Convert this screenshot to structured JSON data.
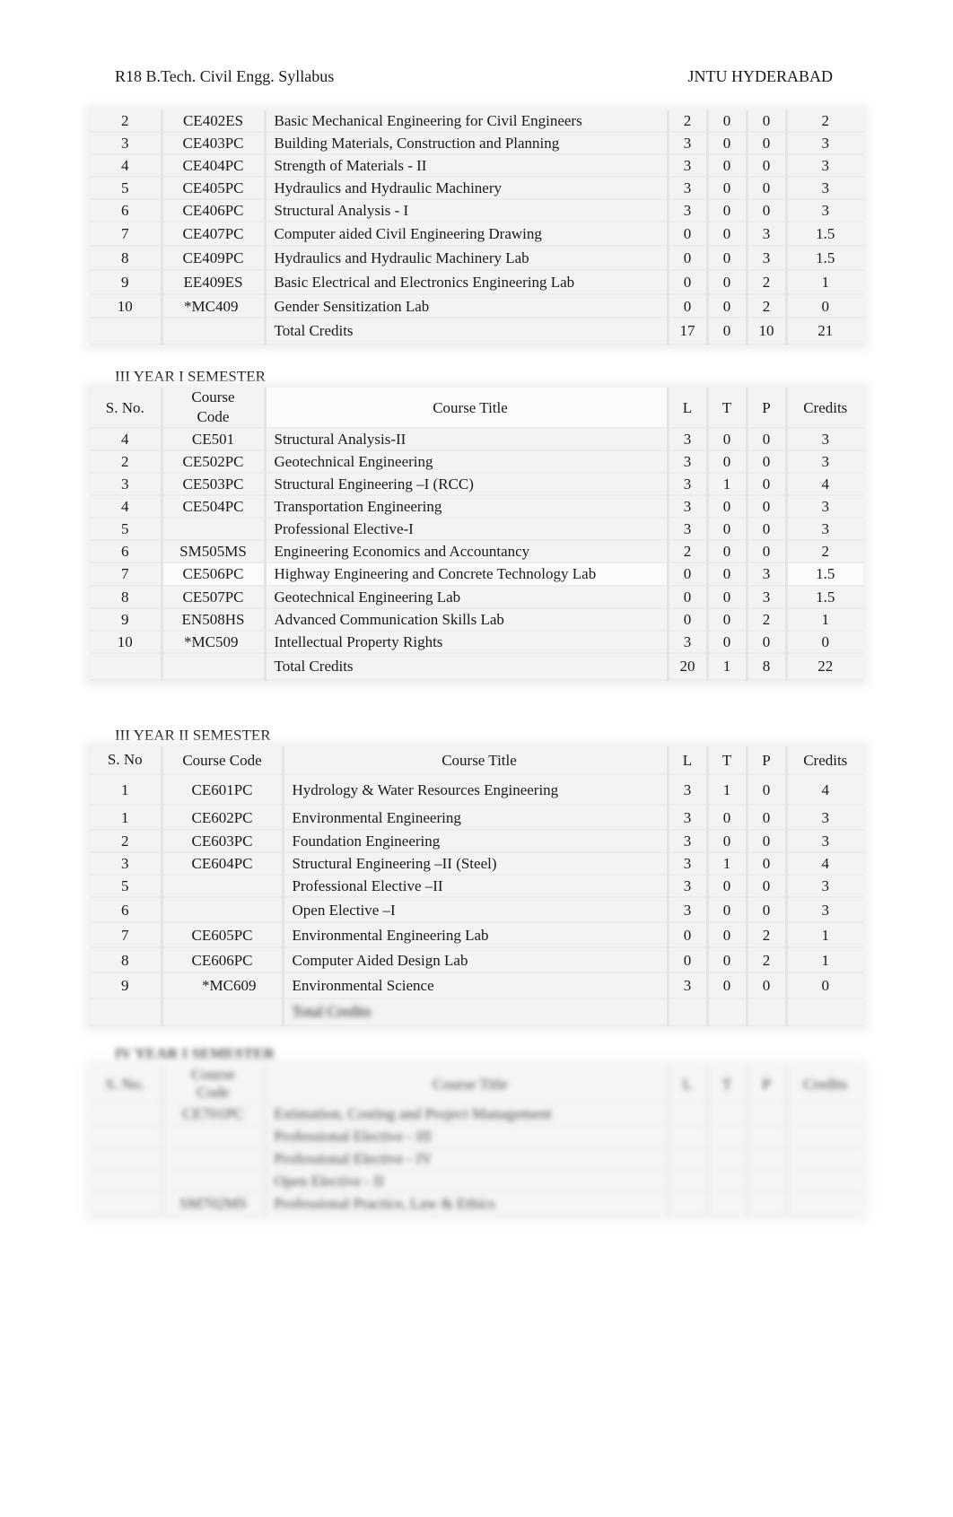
{
  "header": {
    "left": "R18 B.Tech. Civil Engg. Syllabus",
    "right": "JNTU HYDERABAD"
  },
  "table_ii_2": {
    "rows": [
      {
        "sno": "2",
        "code": "CE402ES",
        "title": "Basic Mechanical Engineering for Civil Engineers",
        "l": "2",
        "t": "0",
        "p": "0",
        "credits": "2"
      },
      {
        "sno": "3",
        "code": "CE403PC",
        "title": "Building Materials, Construction and Planning",
        "l": "3",
        "t": "0",
        "p": "0",
        "credits": "3"
      },
      {
        "sno": "4",
        "code": "CE404PC",
        "title": "Strength of Materials - II",
        "l": "3",
        "t": "0",
        "p": "0",
        "credits": "3"
      },
      {
        "sno": "5",
        "code": "CE405PC",
        "title": "Hydraulics and Hydraulic Machinery",
        "l": "3",
        "t": "0",
        "p": "0",
        "credits": "3"
      },
      {
        "sno": "6",
        "code": "CE406PC",
        "title": "Structural Analysis - I",
        "l": "3",
        "t": "0",
        "p": "0",
        "credits": "3"
      },
      {
        "sno": "7",
        "code": "CE407PC",
        "title": "Computer aided Civil Engineering Drawing",
        "l": "0",
        "t": "0",
        "p": "3",
        "credits": "1.5"
      },
      {
        "sno": "8",
        "code": "CE409PC",
        "title": "Hydraulics and Hydraulic Machinery Lab",
        "l": "0",
        "t": "0",
        "p": "3",
        "credits": "1.5"
      },
      {
        "sno": "9",
        "code": "EE409ES",
        "title": "Basic Electrical and Electronics Engineering Lab",
        "l": "0",
        "t": "0",
        "p": "2",
        "credits": "1"
      },
      {
        "sno": "10",
        "code": "*MC409",
        "title": "Gender Sensitization Lab",
        "l": "0",
        "t": "0",
        "p": "2",
        "credits": "0"
      }
    ],
    "total": {
      "label": "Total Credits",
      "l": "17",
      "t": "0",
      "p": "10",
      "credits": "21"
    }
  },
  "table_iii_1": {
    "section_title": "III YEAR I SEMESTER",
    "headers": {
      "sno": "S. No.",
      "code_line1": "Course",
      "code_line2": "Code",
      "title": "Course Title",
      "l": "L",
      "t": "T",
      "p": "P",
      "credits": "Credits"
    },
    "rows": [
      {
        "sno": "4",
        "code": "CE501",
        "title": "Structural Analysis-II",
        "l": "3",
        "t": "0",
        "p": "0",
        "credits": "3"
      },
      {
        "sno": "2",
        "code": "CE502PC",
        "title": "Geotechnical Engineering",
        "l": "3",
        "t": "0",
        "p": "0",
        "credits": "3"
      },
      {
        "sno": "3",
        "code": "CE503PC",
        "title": "Structural Engineering –I    (RCC)",
        "l": "3",
        "t": "1",
        "p": "0",
        "credits": "4"
      },
      {
        "sno": "4",
        "code": "CE504PC",
        "title": "Transportation Engineering",
        "l": "3",
        "t": "0",
        "p": "0",
        "credits": "3"
      },
      {
        "sno": "5",
        "code": "",
        "title": "Professional Elective-I",
        "l": "3",
        "t": "0",
        "p": "0",
        "credits": "3"
      },
      {
        "sno": "6",
        "code": "SM505MS",
        "title": "Engineering Economics and Accountancy",
        "l": "2",
        "t": "0",
        "p": "0",
        "credits": "2"
      },
      {
        "sno": "7",
        "code": "CE506PC",
        "title": "Highway Engineering and Concrete Technology Lab",
        "l": "0",
        "t": "0",
        "p": "3",
        "credits": "1.5"
      },
      {
        "sno": "8",
        "code": "CE507PC",
        "title": "Geotechnical Engineering Lab",
        "l": "0",
        "t": "0",
        "p": "3",
        "credits": "1.5"
      },
      {
        "sno": "9",
        "code": "EN508HS",
        "title": "Advanced Communication Skills Lab",
        "l": "0",
        "t": "0",
        "p": "2",
        "credits": "1"
      },
      {
        "sno": "10",
        "code": "*MC509",
        "title": "Intellectual Property Rights",
        "l": "3",
        "t": "0",
        "p": "0",
        "credits": "0"
      }
    ],
    "total": {
      "label": "Total Credits",
      "l": "20",
      "t": "1",
      "p": "8",
      "credits": "22"
    }
  },
  "table_iii_2": {
    "section_title": "III YEAR II SEMESTER",
    "headers": {
      "sno": "S. No",
      "code": "Course Code",
      "title": "Course Title",
      "l": "L",
      "t": "T",
      "p": "P",
      "credits": "Credits"
    },
    "rows": [
      {
        "sno": "1",
        "code": "CE601PC",
        "title": "Hydrology & Water Resources Engineering",
        "l": "3",
        "t": "1",
        "p": "0",
        "credits": "4"
      },
      {
        "sno": "1",
        "code": "CE602PC",
        "title": "Environmental Engineering",
        "l": "3",
        "t": "0",
        "p": "0",
        "credits": "3"
      },
      {
        "sno": "2",
        "code": "CE603PC",
        "title": "Foundation Engineering",
        "l": "3",
        "t": "0",
        "p": "0",
        "credits": "3"
      },
      {
        "sno": "3",
        "code": "CE604PC",
        "title": "Structural Engineering –II    (Steel)",
        "l": "3",
        "t": "1",
        "p": "0",
        "credits": "4"
      },
      {
        "sno": "5",
        "code": "",
        "title": "Professional Elective –II",
        "l": "3",
        "t": "0",
        "p": "0",
        "credits": "3"
      },
      {
        "sno": "6",
        "code": "",
        "title": "Open Elective –I",
        "l": "3",
        "t": "0",
        "p": "0",
        "credits": "3"
      },
      {
        "sno": "7",
        "code": "CE605PC",
        "title": "Environmental Engineering Lab",
        "l": "0",
        "t": "0",
        "p": "2",
        "credits": "1"
      },
      {
        "sno": "8",
        "code": "CE606PC",
        "title": "Computer Aided Design Lab",
        "l": "0",
        "t": "0",
        "p": "2",
        "credits": "1"
      },
      {
        "sno": "9",
        "code": "*MC609",
        "title": "Environmental Science",
        "l": "3",
        "t": "0",
        "p": "0",
        "credits": "0"
      }
    ],
    "total": {
      "label": "Total Credits",
      "l": "",
      "t": "",
      "p": "",
      "credits": ""
    }
  },
  "table_iv_1": {
    "section_title": "IV YEAR I SEMESTER",
    "headers": {
      "sno": "S. No.",
      "code_line1": "Course",
      "code_line2": "Code",
      "title": "Course Title",
      "l": "L",
      "t": "T",
      "p": "P",
      "credits": "Credits"
    },
    "rows": [
      {
        "sno": "",
        "code": "CE701PC",
        "title": "Estimation, Costing and Project Management",
        "l": "",
        "t": "",
        "p": "",
        "credits": ""
      },
      {
        "sno": "",
        "code": "",
        "title": "Professional Elective - III",
        "l": "",
        "t": "",
        "p": "",
        "credits": ""
      },
      {
        "sno": "",
        "code": "",
        "title": "Professional Elective - IV",
        "l": "",
        "t": "",
        "p": "",
        "credits": ""
      },
      {
        "sno": "",
        "code": "",
        "title": "Open Elective - II",
        "l": "",
        "t": "",
        "p": "",
        "credits": ""
      },
      {
        "sno": "",
        "code": "SM702MS",
        "title": "Professional Practice, Law & Ethics",
        "l": "",
        "t": "",
        "p": "",
        "credits": ""
      }
    ]
  }
}
